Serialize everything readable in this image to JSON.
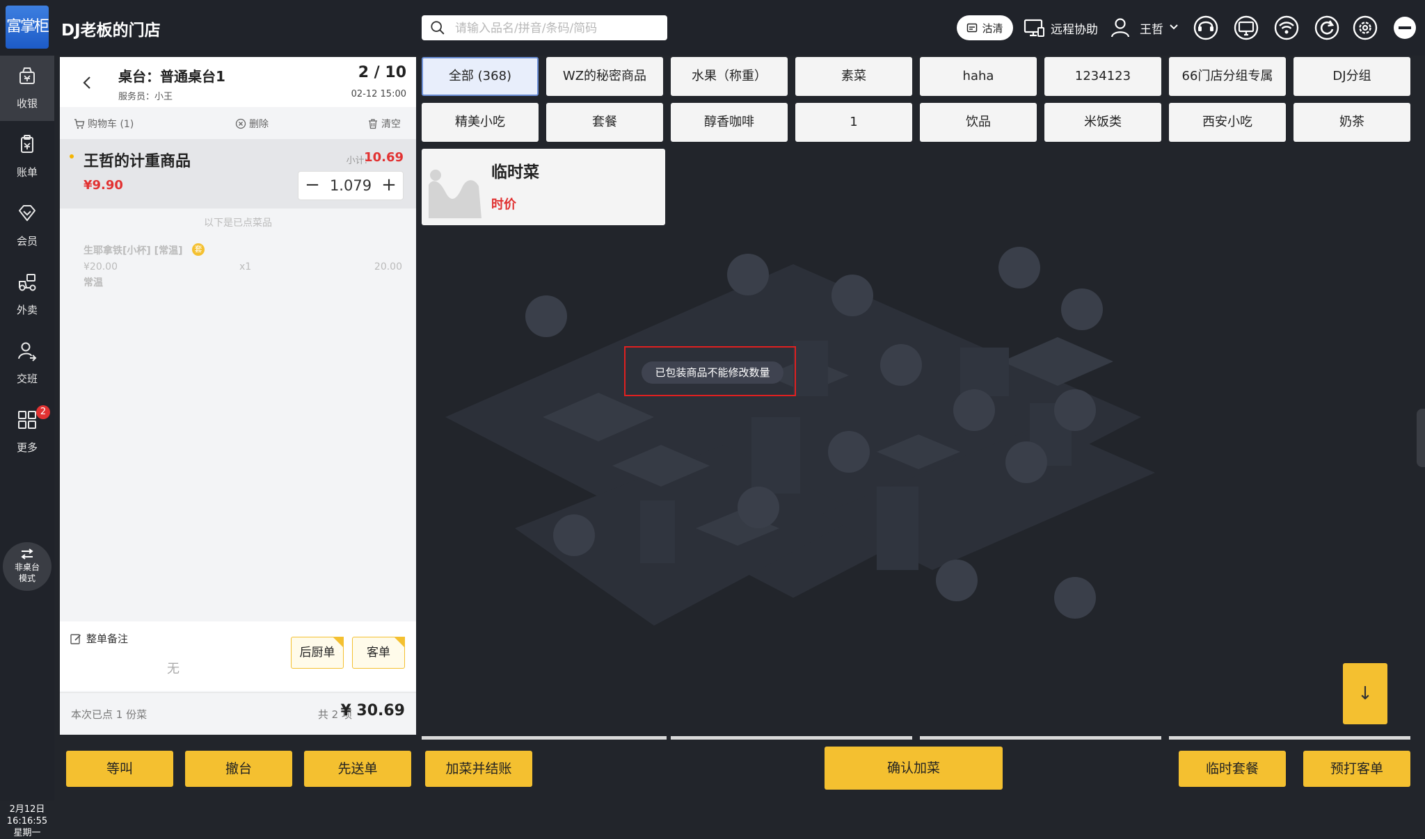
{
  "header": {
    "logo_text": "富掌柜",
    "store_name": "DJ老板的门店",
    "search_placeholder": "请输入品名/拼音/条码/简码",
    "clear_label": "沽清",
    "remote_label": "远程协助",
    "user_name": "王哲"
  },
  "nav": {
    "items": [
      {
        "label": "收银",
        "icon": "cash-register-icon"
      },
      {
        "label": "账单",
        "icon": "bill-icon"
      },
      {
        "label": "会员",
        "icon": "member-icon"
      },
      {
        "label": "外卖",
        "icon": "delivery-icon"
      },
      {
        "label": "交班",
        "icon": "shift-icon"
      },
      {
        "label": "更多",
        "icon": "grid-icon",
        "badge": "2"
      }
    ],
    "mode": {
      "line1": "非桌台",
      "line2": "模式"
    },
    "clock": {
      "date": "2月12日",
      "time": "16:16:55",
      "weekday": "星期一"
    }
  },
  "cart": {
    "table_name": "桌台：普通桌台1",
    "waiter": "服务员：小王",
    "guests": "2 / 10",
    "time": "02-12 15:00",
    "tab_cart": "购物车 (1)",
    "delete_label": "删除",
    "clear_label": "清空",
    "current_item": {
      "name": "王哲的计重商品",
      "subtotal_label": "小计:",
      "subtotal": "10.69",
      "price": "¥9.90",
      "qty": "1.079"
    },
    "ordered_divider": "以下是已点菜品",
    "ordered_item": {
      "name": "生耶拿铁[小杯] [常温]",
      "badge": "套",
      "price": "¥20.00",
      "qty": "x1",
      "amount": "20.00",
      "spec": "常温"
    },
    "note_label": "整单备注",
    "note_value": "无",
    "kitchen_label": "后厨单",
    "customer_label": "客单",
    "footer_left": "本次已点 1 份菜",
    "footer_count": "共 2 项",
    "footer_total": "¥ 30.69"
  },
  "categories": [
    "全部 (368)",
    "WZ的秘密商品",
    "水果（称重）",
    "素菜",
    "haha",
    "1234123",
    "66门店分组专属",
    "DJ分组",
    "精美小吃",
    "套餐",
    "醇香咖啡",
    "1",
    "饮品",
    "米饭类",
    "西安小吃",
    "奶茶"
  ],
  "product": {
    "name": "临时菜",
    "price": "时价"
  },
  "toast": "已包装商品不能修改数量",
  "actions": {
    "wait": "等叫",
    "clear_table": "撤台",
    "send_first": "先送单",
    "add_and_checkout": "加菜并结账",
    "confirm": "确认加菜",
    "temp_set": "临时套餐",
    "preprint": "预打客单"
  },
  "colors": {
    "accent_yellow": "#f4c030",
    "price_red": "#e23232",
    "dark_bg": "#20232a"
  }
}
